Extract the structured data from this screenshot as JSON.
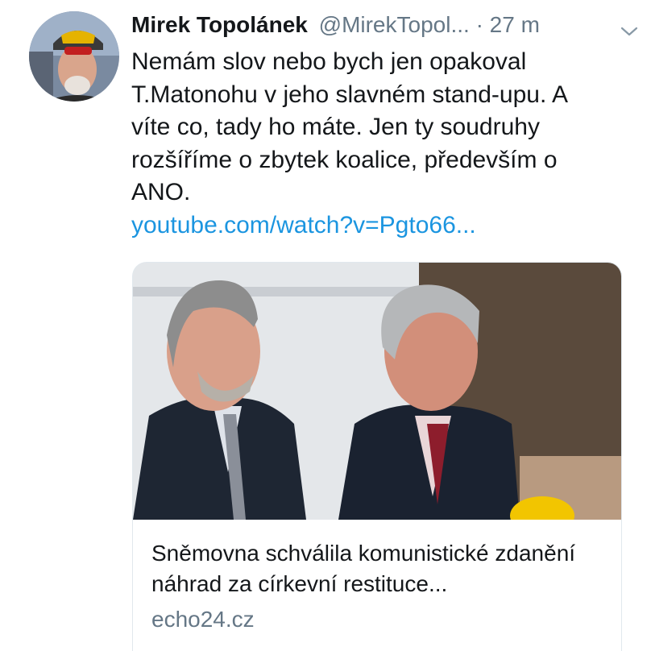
{
  "author": {
    "name": "Mirek Topolánek",
    "handle": "@MirekTopol...",
    "separator": "·",
    "time": "27 m"
  },
  "tweet": {
    "text": "Nemám slov nebo bych jen opakoval\nT.Matonohu v jeho slavném stand-upu. A\nvíte co, tady ho máte.  Jen ty soudruhy\nrozšíříme o zbytek koalice, především o\nANO.",
    "link": "youtube.com/watch?v=Pgto66..."
  },
  "card": {
    "title": "Sněmovna schválila komunistické zdanění náhrad za církevní restituce...",
    "domain": "echo24.cz"
  },
  "icons": {
    "menu": "chevron-down-icon"
  },
  "colors": {
    "link": "#1b95e0",
    "secondary_text": "#657786",
    "border": "#e1e8ed"
  }
}
